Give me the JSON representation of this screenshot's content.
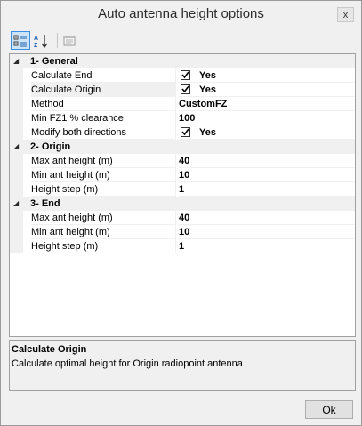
{
  "window": {
    "title": "Auto antenna height options",
    "close_glyph": "x"
  },
  "toolbar": {
    "buttons": [
      {
        "name": "categorized-view-icon",
        "active": true
      },
      {
        "name": "alphabetical-sort-icon",
        "active": false
      },
      {
        "name": "property-pages-icon",
        "active": false
      }
    ]
  },
  "grid": {
    "categories": [
      {
        "label": "1- General",
        "properties": [
          {
            "name": "Calculate End",
            "value": "Yes",
            "type": "checkbox",
            "checked": true
          },
          {
            "name": "Calculate Origin",
            "value": "Yes",
            "type": "checkbox",
            "checked": true,
            "selected": true
          },
          {
            "name": "Method",
            "value": "CustomFZ",
            "type": "text"
          },
          {
            "name": "Min FZ1 % clearance",
            "value": "100",
            "type": "text"
          },
          {
            "name": "Modify both directions",
            "value": "Yes",
            "type": "checkbox",
            "checked": true
          }
        ]
      },
      {
        "label": "2- Origin",
        "properties": [
          {
            "name": "Max ant height (m)",
            "value": "40",
            "type": "text"
          },
          {
            "name": "Min ant height (m)",
            "value": "10",
            "type": "text"
          },
          {
            "name": "Height step (m)",
            "value": "1",
            "type": "text"
          }
        ]
      },
      {
        "label": "3- End",
        "properties": [
          {
            "name": "Max ant height (m)",
            "value": "40",
            "type": "text"
          },
          {
            "name": "Min ant height (m)",
            "value": "10",
            "type": "text"
          },
          {
            "name": "Height step (m)",
            "value": "1",
            "type": "text"
          }
        ]
      }
    ]
  },
  "help": {
    "title": "Calculate Origin",
    "description": "Calculate optimal height for Origin radiopoint antenna"
  },
  "footer": {
    "ok_label": "Ok"
  },
  "colors": {
    "window_bg": "#f0f0f0",
    "active_button_bg": "#cce4f7",
    "active_button_border": "#3d8ee0"
  }
}
